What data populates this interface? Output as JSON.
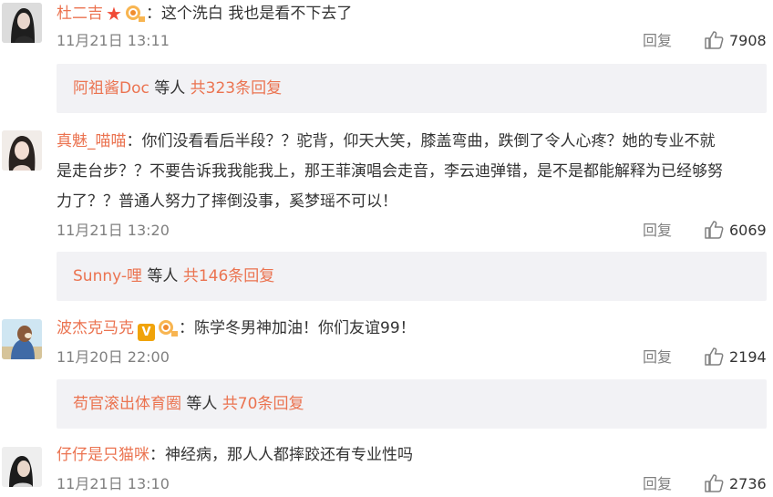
{
  "comments": [
    {
      "username": "杜二吉",
      "text": "：这个洗白 我也是看不下去了",
      "time": "11月21日 13:11",
      "reply_label": "回复",
      "likes": "7908",
      "sub": {
        "who": "阿祖酱Doc",
        "and": "等人",
        "total": "共323条回复"
      }
    },
    {
      "username": "真魅_喵喵",
      "text_lines": [
        "：你们没看看后半段？？驼背，仰天大笑，膝盖弯曲，跌倒了令人心疼？她的专业不就",
        "是走台步？？不要告诉我我能我上，那王菲演唱会走音，李云迪弹错，是不是都能解释为已经够努",
        "力了？？普通人努力了摔倒没事，奚梦瑶不可以！"
      ],
      "time": "11月21日 13:20",
      "reply_label": "回复",
      "likes": "6069",
      "sub": {
        "who": "Sunny-哩",
        "and": "等人",
        "total": "共146条回复"
      }
    },
    {
      "username": "波杰克马克",
      "text": "：陈学冬男神加油！你们友谊99！",
      "time": "11月20日 22:00",
      "reply_label": "回复",
      "likes": "2194",
      "sub": {
        "who": "苟官滚出体育圈",
        "and": "等人",
        "total": "共70条回复"
      }
    },
    {
      "username": "仔仔是只猫咪",
      "text": "：神经病，那人人都摔跤还有专业性吗",
      "time": "11月21日 13:10",
      "reply_label": "回复",
      "likes": "2736"
    }
  ],
  "badges": {
    "vip_letter": "V",
    "star_glyph": "★",
    "accent_color": "#eb7350",
    "sub_bg_color": "#f2f2f5"
  },
  "icons": [
    "thumbs-up-icon",
    "star-badge-icon",
    "vip-v-badge-icon",
    "medal-badge-icon"
  ]
}
